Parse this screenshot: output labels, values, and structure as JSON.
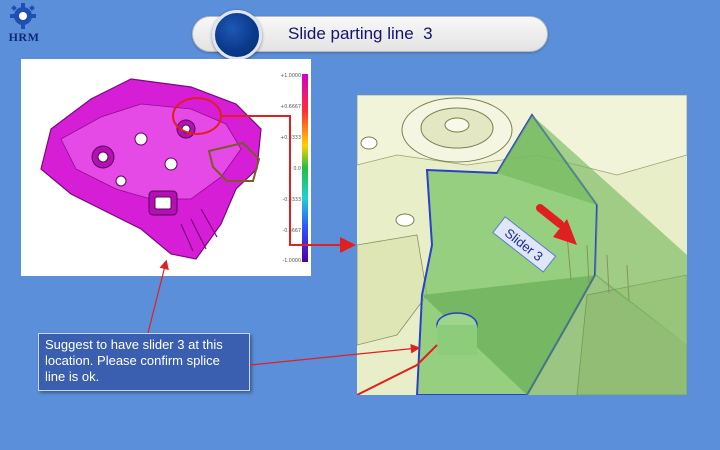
{
  "logo": {
    "text": "HRM"
  },
  "title": "Slide parting line  3",
  "scale_bar": {
    "ticks": [
      "+1.0000",
      "+0.6667",
      "+0.3333",
      "0.0",
      "-0.3333",
      "-0.6667",
      "-1.0000"
    ]
  },
  "slider_label": "Slider 3",
  "callout": {
    "text": "Suggest to have slider 3 at this location. Please confirm splice line is ok."
  },
  "colors": {
    "background": "#5b8fd9",
    "part_magenta": "#d61ed6",
    "slider_green": "#7cc46a",
    "arrow_red": "#e02020",
    "callout_blue": "#3a5fb0"
  }
}
